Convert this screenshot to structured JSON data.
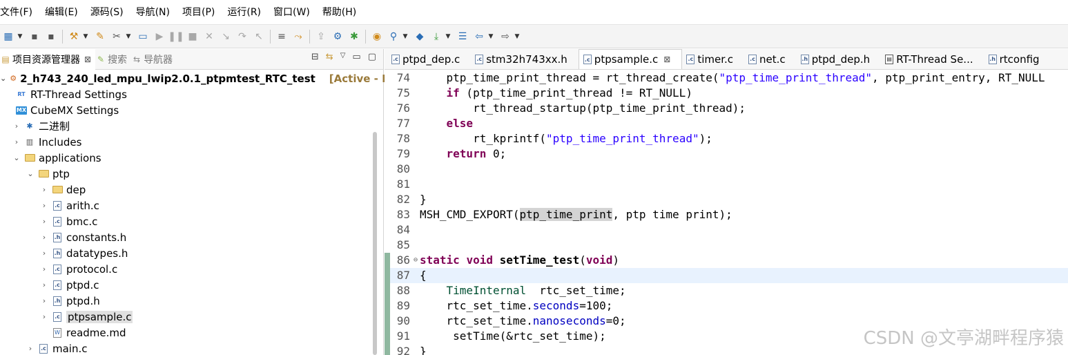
{
  "menu": [
    {
      "id": "file",
      "label": "文件(F)"
    },
    {
      "id": "edit",
      "label": "编辑(E)"
    },
    {
      "id": "source",
      "label": "源码(S)"
    },
    {
      "id": "navigate",
      "label": "导航(N)"
    },
    {
      "id": "project",
      "label": "项目(P)"
    },
    {
      "id": "run",
      "label": "运行(R)"
    },
    {
      "id": "window",
      "label": "窗口(W)"
    },
    {
      "id": "help",
      "label": "帮助(H)"
    }
  ],
  "left_panel": {
    "tabs": [
      {
        "label": "项目资源管理器",
        "active": true
      },
      {
        "label": "搜索",
        "active": false
      },
      {
        "label": "导航器",
        "active": false
      }
    ],
    "close_glyph": "⊠"
  },
  "tree": {
    "project": {
      "label": "2_h743_240_led_mpu_lwip2.0.1_ptpmtest_RTC_test",
      "status": "[Active - Deb"
    },
    "items": [
      {
        "label": "RT-Thread Settings",
        "icon": "rt-thread-icon"
      },
      {
        "label": "CubeMX Settings",
        "icon": "cubemx-icon"
      },
      {
        "label": "二进制",
        "icon": "binaries-icon"
      },
      {
        "label": "Includes",
        "icon": "includes-icon"
      },
      {
        "label": "applications",
        "icon": "folder-icon"
      },
      {
        "label": "ptp",
        "icon": "folder-icon"
      },
      {
        "label": "dep",
        "icon": "folder-icon"
      },
      {
        "label": "arith.c",
        "icon": "c-file-icon"
      },
      {
        "label": "bmc.c",
        "icon": "c-file-icon"
      },
      {
        "label": "constants.h",
        "icon": "h-file-icon"
      },
      {
        "label": "datatypes.h",
        "icon": "h-file-icon"
      },
      {
        "label": "protocol.c",
        "icon": "c-file-icon"
      },
      {
        "label": "ptpd.c",
        "icon": "c-file-icon"
      },
      {
        "label": "ptpd.h",
        "icon": "h-file-icon"
      },
      {
        "label": "ptpsample.c",
        "icon": "c-file-icon"
      },
      {
        "label": "readme.md",
        "icon": "md-file-icon"
      },
      {
        "label": "main.c",
        "icon": "c-file-icon"
      }
    ]
  },
  "editor": {
    "tabs": [
      {
        "label": "ptpd_dep.c",
        "active": false
      },
      {
        "label": "stm32h743xx.h",
        "active": false
      },
      {
        "label": "ptpsample.c",
        "active": true
      },
      {
        "label": "timer.c",
        "active": false
      },
      {
        "label": "net.c",
        "active": false
      },
      {
        "label": "ptpd_dep.h",
        "active": false
      },
      {
        "label": "RT-Thread Se...",
        "active": false
      },
      {
        "label": "rtconfig",
        "active": false
      }
    ],
    "line_numbers": [
      "74",
      "75",
      "76",
      "77",
      "78",
      "79",
      "80",
      "81",
      "82",
      "83",
      "84",
      "85",
      "86",
      "87",
      "88",
      "89",
      "90",
      "91",
      "92"
    ],
    "lines": {
      "l74": {
        "a": "    ptp_time_print_thread = rt_thread_create(",
        "s": "\"ptp_time_print_thread\"",
        "b": ", ptp_print_entry, RT_NULL"
      },
      "l75": {
        "kw": "    if",
        "rest": " (ptp_time_print_thread != RT_NULL)"
      },
      "l76": {
        "text": "        rt_thread_startup(ptp_time_print_thread);"
      },
      "l77": {
        "kw": "    else"
      },
      "l78": {
        "a": "        rt_kprintf(",
        "s": "\"ptp_time_print_thread\"",
        "b": ");"
      },
      "l79": {
        "kw": "    return",
        "rest": " 0;"
      },
      "l82": {
        "text": "}"
      },
      "l83": {
        "a": "MSH_CMD_EXPORT(",
        "hl": "ptp_time_print",
        "b": ", ptp time print);"
      },
      "l86": {
        "kw1": "static",
        "sp1": " ",
        "kw2": "void",
        "sp2": " ",
        "fn": "setTime_test",
        "p1": "(",
        "kw3": "void",
        "p2": ")"
      },
      "l87": {
        "text": "{"
      },
      "l88": {
        "ind": "    ",
        "type": "TimeInternal",
        "rest": "  rtc_set_time;"
      },
      "l89": {
        "a": "    rtc_set_time.",
        "f": "seconds",
        "b": "=100;"
      },
      "l90": {
        "a": "    rtc_set_time.",
        "f": "nanoseconds",
        "b": "=0;"
      },
      "l91": {
        "text": "     setTime(&rtc_set_time);"
      },
      "l92": {
        "text": "}"
      }
    }
  },
  "watermark": "CSDN @文亭湖畔程序猿",
  "colors": {
    "keyword": "#7f0055",
    "string": "#2a00ff",
    "field": "#0000c0",
    "type": "#005032",
    "current_line": "#e8f2fe"
  }
}
